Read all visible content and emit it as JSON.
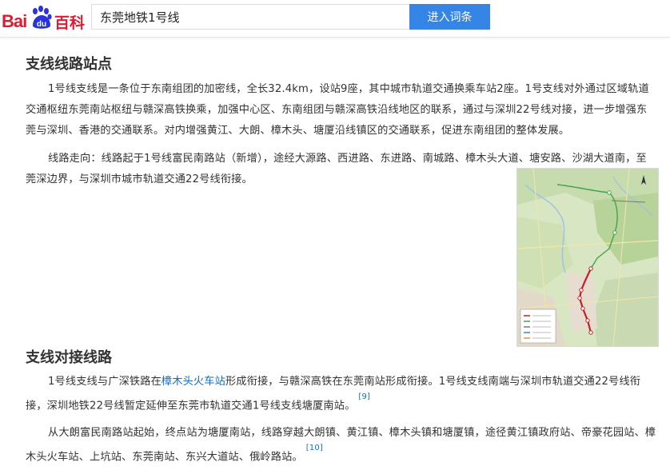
{
  "header": {
    "logo_left": "Bai",
    "logo_right": "百科",
    "logo_paw_text": "du",
    "search_value": "东莞地铁1号线",
    "search_button_label": "进入词条"
  },
  "section1": {
    "heading": "支线线路站点",
    "para1": "1号线支线是一条位于东南组团的加密线，全长32.4km，设站9座，其中城市轨道交通换乘车站2座。1号支线对外通过区域轨道交通枢纽东莞南站枢纽与赣深高铁换乘，加强中心区、东南组团与赣深高铁沿线地区的联系，通过与深圳22号线对接，进一步增强东莞与深圳、香港的交通联系。对内增强黄江、大朗、樟木头、塘厦沿线镇区的交通联系，促进东南组团的整体发展。",
    "para2": "线路走向：线路起于1号线富民南路站（新增），途经大源路、西进路、东进路、南城路、樟木头大道、塘安路、沙湖大道南，至莞深边界，与深圳市城市轨道交通22号线衔接。"
  },
  "section2": {
    "heading": "支线对接线路",
    "para1_before_link": "1号线支线与广深铁路在",
    "para1_link": "樟木头火车站",
    "para1_after_link": "形成衔接，与赣深高铁在东莞南站形成衔接。1号线支线南端与深圳市轨道交通22号线衔接，深圳地铁22号线暂定延伸至东莞市轨道交通1号线支线塘厦南站。",
    "para1_ref": "[9]",
    "para2": "从大朗富民南路站起始，终点站为塘厦南站，线路穿越大朗镇、黄江镇、樟木头镇和塘厦镇，途径黄江镇政府站、帝豪花园站、樟木头火车站、上坑站、东莞南站、东兴大道站、俄岭路站。",
    "para2_ref": "[10]"
  },
  "colors": {
    "brand_red": "#de1c31",
    "brand_blue": "#2932e1",
    "button_blue": "#3585e6",
    "link_blue": "#136ec2",
    "text": "#333333",
    "map_route_red": "#c0202a"
  },
  "icons": {
    "logo_paw": "baidu-paw-icon",
    "map_image": "route-map-image"
  }
}
